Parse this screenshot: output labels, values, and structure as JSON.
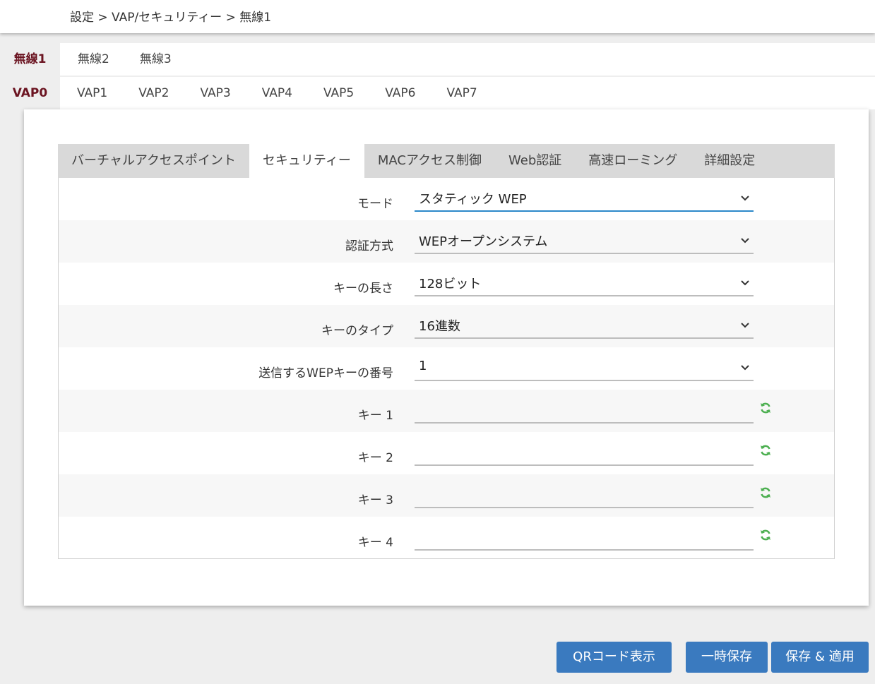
{
  "breadcrumb": "設定 > VAP/セキュリティー > 無線1",
  "radio_tabs": {
    "active": "無線1",
    "others": [
      "無線2",
      "無線3"
    ]
  },
  "vap_tabs": {
    "active": "VAP0",
    "others": [
      "VAP1",
      "VAP2",
      "VAP3",
      "VAP4",
      "VAP5",
      "VAP6",
      "VAP7"
    ]
  },
  "sub_tabs": [
    {
      "label": "バーチャルアクセスポイント",
      "active": false
    },
    {
      "label": "セキュリティー",
      "active": true
    },
    {
      "label": "MACアクセス制御",
      "active": false
    },
    {
      "label": "Web認証",
      "active": false
    },
    {
      "label": "高速ローミング",
      "active": false
    },
    {
      "label": "詳細設定",
      "active": false
    }
  ],
  "form": {
    "mode": {
      "label": "モード",
      "value": "スタティック WEP"
    },
    "auth_method": {
      "label": "認証方式",
      "value": "WEPオープンシステム"
    },
    "key_length": {
      "label": "キーの長さ",
      "value": "128ビット"
    },
    "key_type": {
      "label": "キーのタイプ",
      "value": "16進数"
    },
    "tx_key_index": {
      "label": "送信するWEPキーの番号",
      "value": "1"
    },
    "keys": [
      {
        "label": "キー 1",
        "value": ""
      },
      {
        "label": "キー 2",
        "value": ""
      },
      {
        "label": "キー 3",
        "value": ""
      },
      {
        "label": "キー 4",
        "value": ""
      }
    ]
  },
  "buttons": {
    "qr": "QRコード表示",
    "temp_save": "一時保存",
    "save_apply": "保存 & 適用"
  },
  "colors": {
    "accent_button": "#3a7abf",
    "active_tab_text": "#6b1421",
    "focus_underline": "#2b88c9",
    "refresh_icon": "#4caf50"
  }
}
